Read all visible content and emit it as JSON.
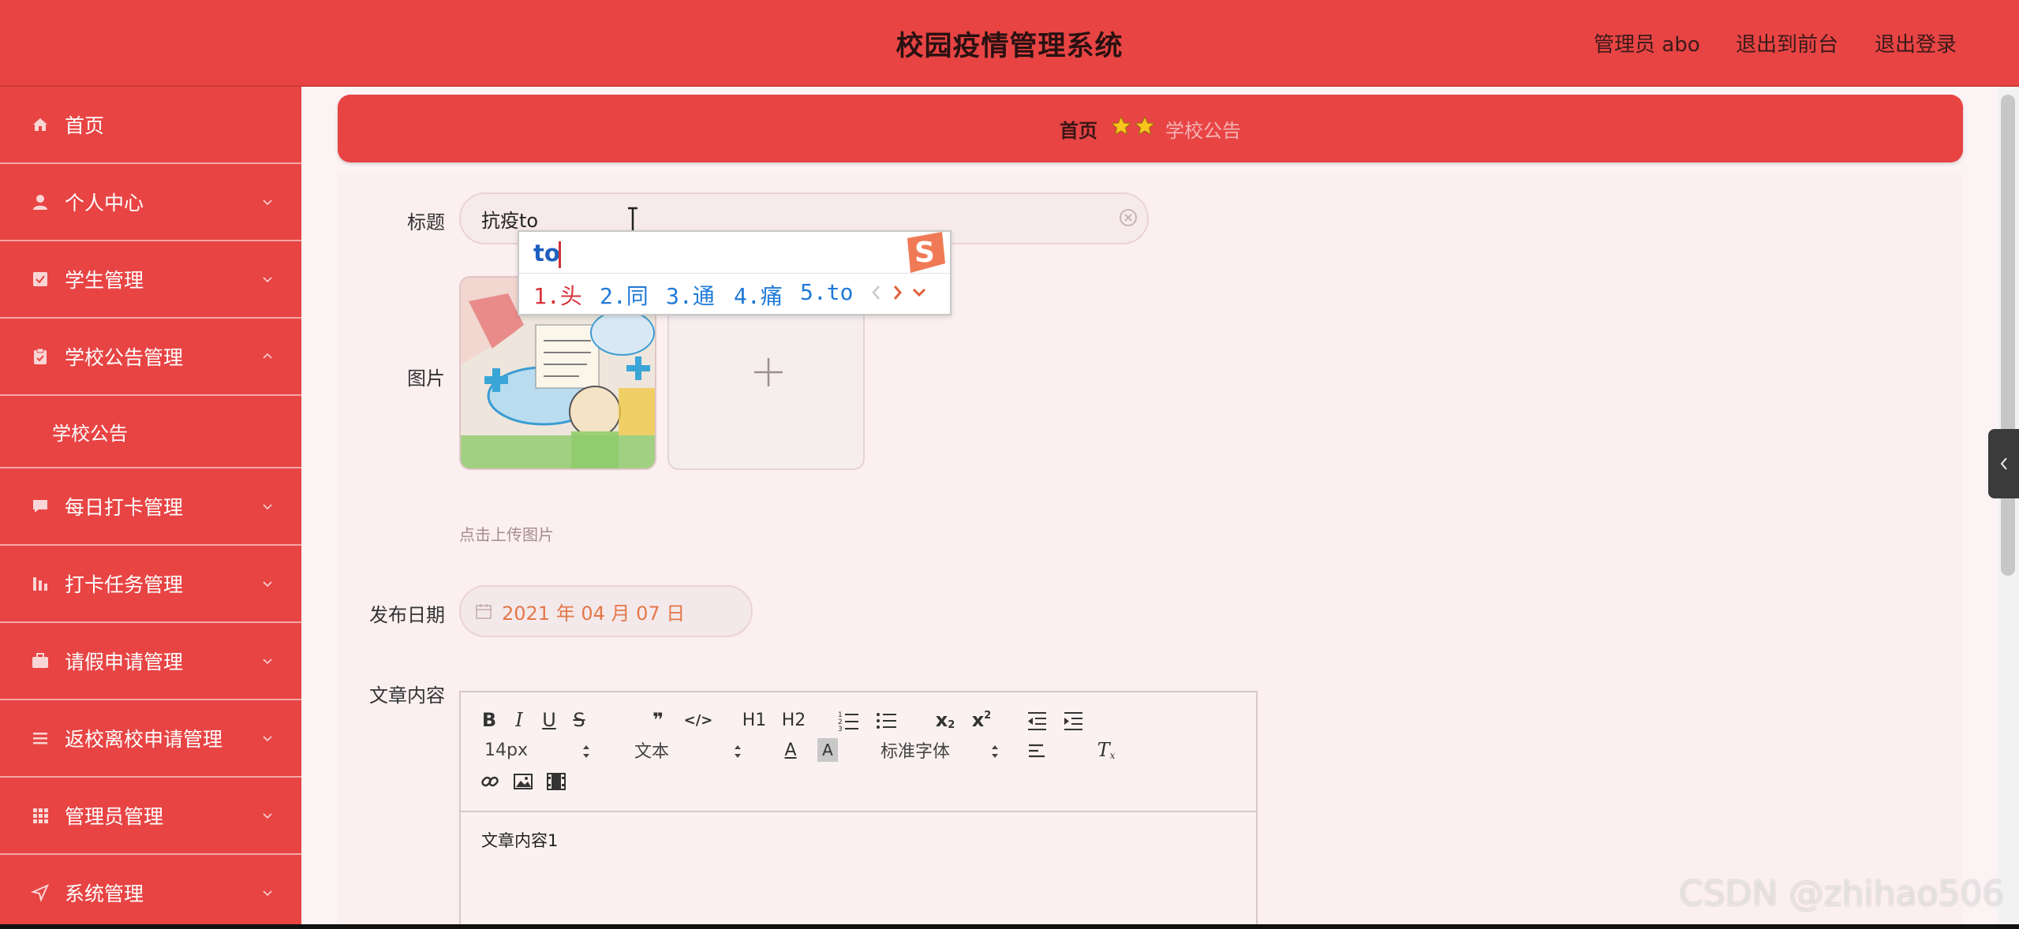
{
  "header": {
    "title": "校园疫情管理系统",
    "admin_label": "管理员 abo",
    "exit_front_label": "退出到前台",
    "logout_label": "退出登录"
  },
  "sidebar": {
    "items": [
      {
        "label": "首页",
        "icon": "home-icon"
      },
      {
        "label": "个人中心",
        "icon": "user-icon"
      },
      {
        "label": "学生管理",
        "icon": "checkbox-icon"
      },
      {
        "label": "学校公告管理",
        "icon": "clipboard-icon"
      },
      {
        "label": "学校公告",
        "icon": ""
      },
      {
        "label": "每日打卡管理",
        "icon": "chat-icon"
      },
      {
        "label": "打卡任务管理",
        "icon": "bar-chart-icon"
      },
      {
        "label": "请假申请管理",
        "icon": "briefcase-icon"
      },
      {
        "label": "返校离校申请管理",
        "icon": "list-icon"
      },
      {
        "label": "管理员管理",
        "icon": "grid-icon"
      },
      {
        "label": "系统管理",
        "icon": "send-icon"
      }
    ]
  },
  "breadcrumb": {
    "home": "首页",
    "current": "学校公告"
  },
  "form": {
    "title_label": "标题",
    "title_value": "抗疫to",
    "image_label": "图片",
    "upload_hint": "点击上传图片",
    "date_label": "发布日期",
    "date_value": "2021 年 04 月 07 日",
    "content_label": "文章内容",
    "content_value": "文章内容1"
  },
  "ime": {
    "composition": "to",
    "candidates": [
      "1.头",
      "2.同",
      "3.通",
      "4.痛",
      "5.to"
    ]
  },
  "editor": {
    "font_size": "14px",
    "block_type": "文本",
    "font_family": "标准字体",
    "h1": "H1",
    "h2": "H2"
  },
  "watermark": "CSDN @zhihao506",
  "colors": {
    "primary": "#e84444",
    "date_text": "#e4774a",
    "ime_text": "#1f7ad8"
  }
}
